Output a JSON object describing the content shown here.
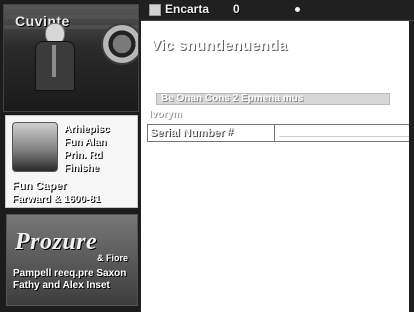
{
  "app": {
    "brand_label": "Cuvinte"
  },
  "toolbar": {
    "label_1": "Encarta",
    "label_2": "0"
  },
  "sidebar": {
    "profile": {
      "lines": "Arhiepisc\nFun Alan\nPrin. Rd\nFinishe",
      "name": "Fun Caper",
      "date": "Farward & 1600-81"
    },
    "banner": {
      "title": "Prozure",
      "subtitle": "& Fiore",
      "caption": "Pampell reeq.pre Saxon\nFathy and Alex Inset"
    }
  },
  "main": {
    "headline": "Vic snundenuenda",
    "search_bar_text": "Be Onan Cons 2 Epmena mus",
    "small_label": "Ivorym",
    "field_label": "Serial Number",
    "field_marker": "#",
    "field_value": "________________________"
  }
}
